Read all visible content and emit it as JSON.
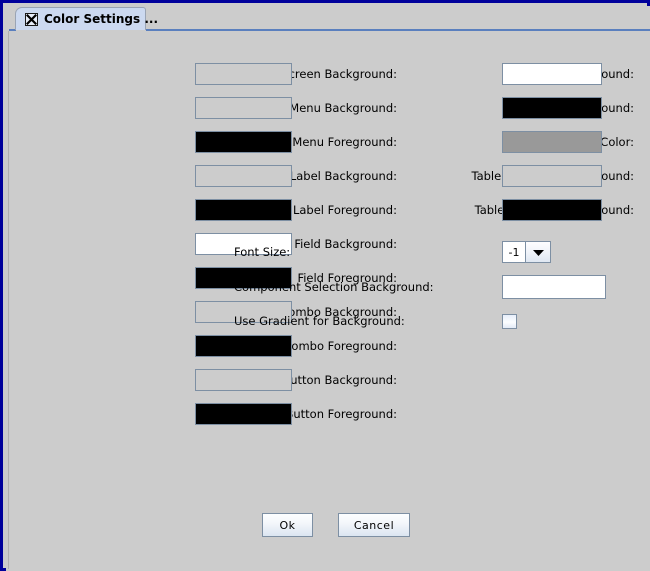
{
  "window": {
    "border_color": "#00009b",
    "background": "#cccccc"
  },
  "tab": {
    "title": "Color Settings ...",
    "close_icon": "close-x-icon"
  },
  "left_column": [
    {
      "label": "Screen Background:",
      "swatch": "#cccccc",
      "name": "screen-background"
    },
    {
      "label": "Menu Background:",
      "swatch": "#cccccc",
      "name": "menu-background"
    },
    {
      "label": "Menu Foreground:",
      "swatch": "#000000",
      "name": "menu-foreground"
    },
    {
      "label": "Label Background:",
      "swatch": "#cccccc",
      "name": "label-background"
    },
    {
      "label": "Label Foreground:",
      "swatch": "#000000",
      "name": "label-foreground"
    },
    {
      "label": "Field Background:",
      "swatch": "#ffffff",
      "name": "field-background"
    },
    {
      "label": "Field Foreground:",
      "swatch": "#000000",
      "name": "field-foreground"
    },
    {
      "label": "Combo Background:",
      "swatch": "#cccccc",
      "name": "combo-background"
    },
    {
      "label": "Combo Foreground:",
      "swatch": "#000000",
      "name": "combo-foreground"
    },
    {
      "label": "Button Background:",
      "swatch": "#cccccc",
      "name": "button-background"
    },
    {
      "label": "Button Foreground:",
      "swatch": "#000000",
      "name": "button-foreground"
    }
  ],
  "right_column": [
    {
      "label": "Table Background:",
      "swatch": "#ffffff",
      "name": "table-background"
    },
    {
      "label": "Table Foreground:",
      "swatch": "#000000",
      "name": "table-foreground"
    },
    {
      "label": "Table Grig Color:",
      "swatch": "#999999",
      "name": "table-grid-color"
    },
    {
      "label": "Table Selection Background:",
      "swatch": "#cccccc",
      "name": "table-selection-background"
    },
    {
      "label": "Table Selection Foreground:",
      "swatch": "#000000",
      "name": "table-selection-foreground"
    }
  ],
  "font_size": {
    "label": "Font Size:",
    "value": "-1",
    "arrow_icon": "chevron-down-icon"
  },
  "component_selection": {
    "label": "Component Selection Background:",
    "swatch": "#ffffff"
  },
  "use_gradient": {
    "label": "Use Gradient for Background:",
    "checked": false
  },
  "buttons": {
    "ok": "Ok",
    "cancel": "Cancel"
  }
}
